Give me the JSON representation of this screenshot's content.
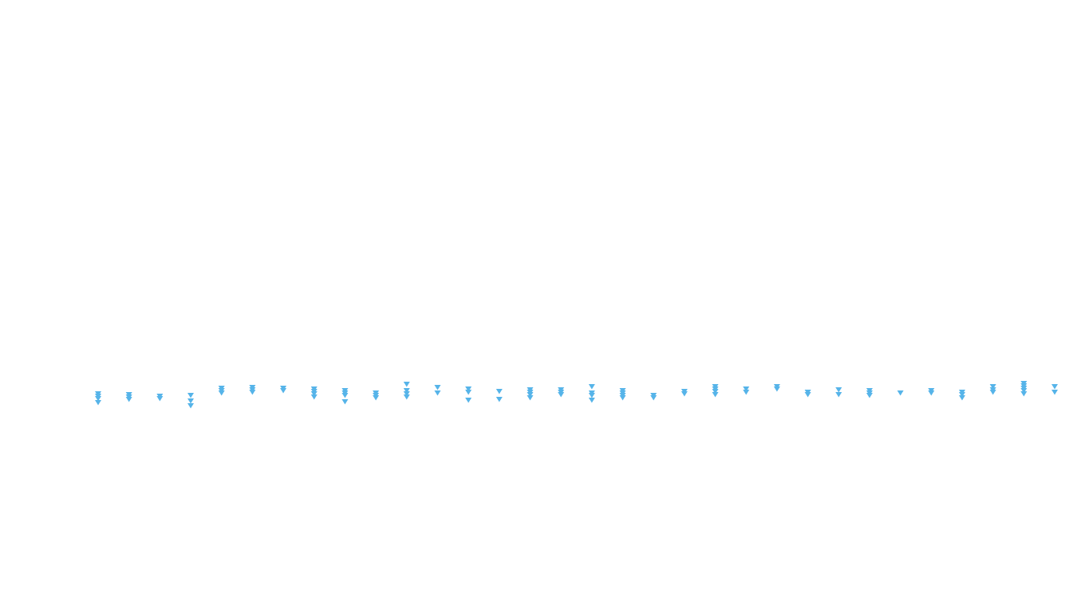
{
  "chart_data": {
    "type": "scatter",
    "marker": "triangle-down",
    "color": "#56b4e9",
    "grid": false,
    "legend": "none",
    "x": [
      1,
      2,
      3,
      4,
      5,
      6,
      7,
      8,
      9,
      10,
      11,
      12,
      13,
      14,
      15,
      16,
      17,
      18,
      19,
      20,
      21,
      22,
      23,
      24,
      25,
      26,
      27,
      28,
      29,
      30,
      31,
      32
    ],
    "ylim": [
      -30,
      30
    ],
    "points_per_x": [
      [
        6,
        3,
        0,
        -5
      ],
      [
        5,
        2,
        -1
      ],
      [
        3,
        0
      ],
      [
        4,
        -3,
        -9
      ],
      [
        13,
        10,
        7
      ],
      [
        14,
        11,
        8
      ],
      [
        13,
        10
      ],
      [
        12,
        9,
        6,
        2
      ],
      [
        10,
        7,
        4,
        -4
      ],
      [
        7,
        4,
        1
      ],
      [
        18,
        10,
        6,
        2
      ],
      [
        14,
        7
      ],
      [
        12,
        8,
        -2
      ],
      [
        9,
        -1
      ],
      [
        11,
        8,
        5,
        1
      ],
      [
        11,
        8,
        5
      ],
      [
        15,
        7,
        4,
        -2
      ],
      [
        10,
        7,
        4,
        1
      ],
      [
        4,
        1
      ],
      [
        9,
        6
      ],
      [
        15,
        12,
        9,
        5
      ],
      [
        12,
        8
      ],
      [
        15,
        12
      ],
      [
        8,
        5
      ],
      [
        11,
        5
      ],
      [
        10,
        7,
        4
      ],
      [
        7
      ],
      [
        10,
        7
      ],
      [
        8,
        5,
        1
      ],
      [
        15,
        11,
        8
      ],
      [
        19,
        16,
        13,
        10,
        6
      ],
      [
        15,
        8
      ]
    ]
  }
}
